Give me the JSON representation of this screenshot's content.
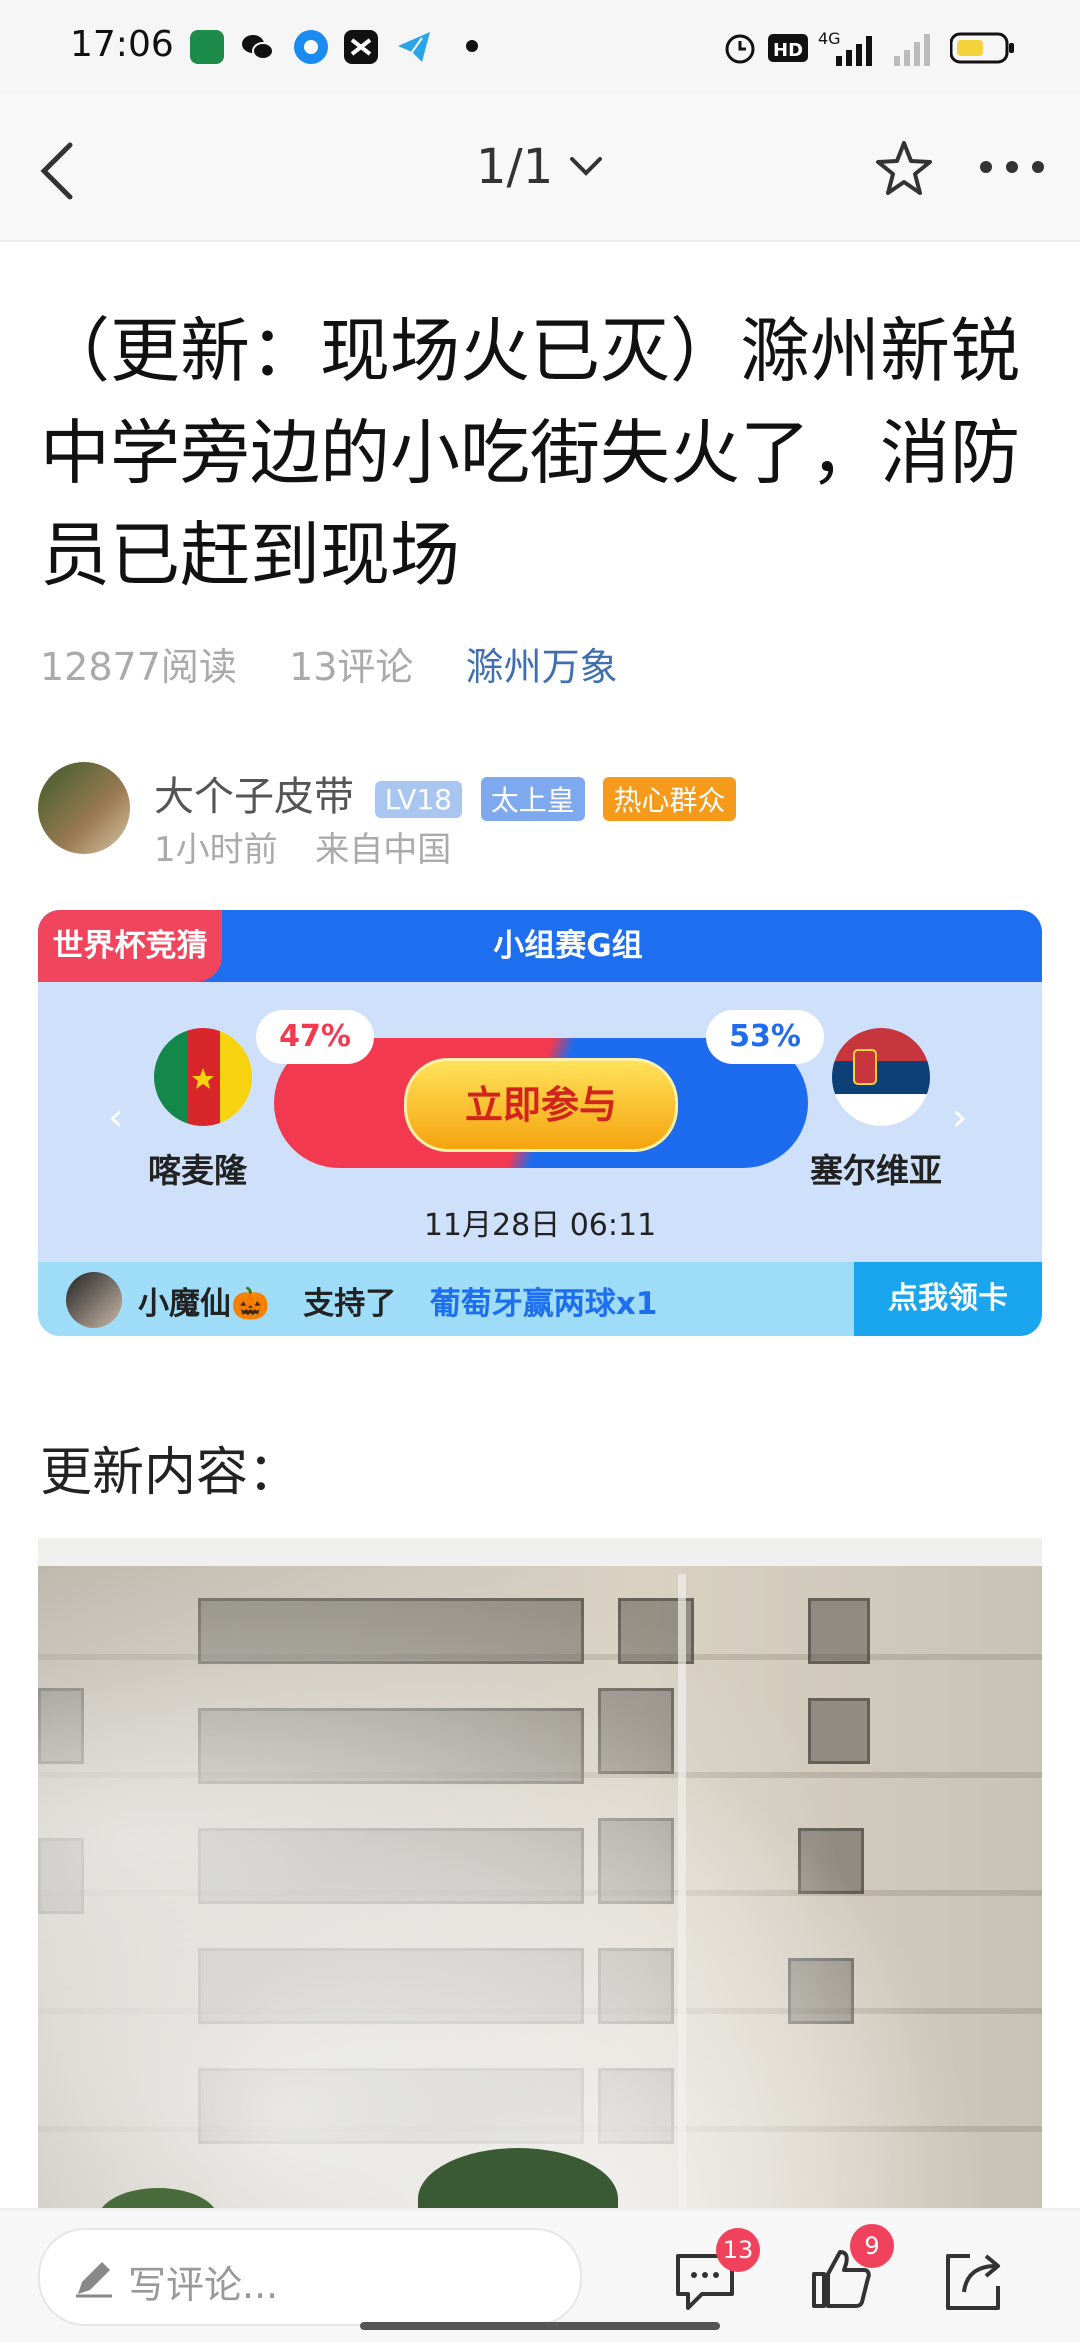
{
  "status_bar": {
    "time": "17:06",
    "icons": [
      "oppo-app-icon",
      "wechat-icon",
      "browser-icon",
      "capcut-icon",
      "telegram-icon",
      "alarm-icon",
      "hd-icon",
      "signal-4g-icon",
      "signal-icon",
      "battery-icon"
    ]
  },
  "nav": {
    "page_indicator": "1/1"
  },
  "article": {
    "title": "（更新：现场火已灭）滁州新锐中学旁边的小吃街失火了，消防员已赶到现场",
    "reads": "12877阅读",
    "comments": "13评论",
    "source": "滁州万象"
  },
  "author": {
    "name": "大个子皮带",
    "level": "LV18",
    "badge1": "太上皇",
    "badge2": "热心群众",
    "time": "1小时前",
    "origin": "来自中国"
  },
  "prediction_card": {
    "tag": "世界杯竞猜",
    "group": "小组赛G组",
    "team_left": "喀麦隆",
    "team_right": "塞尔维亚",
    "pct_left": "47%",
    "pct_right": "53%",
    "join_label": "立即参与",
    "datetime": "11月28日 06:11",
    "supporter_name": "小魔仙🎃",
    "supporter_action": "支持了",
    "supporter_pick": "葡萄牙赢两球x1",
    "claim_label": "点我领卡",
    "colors": {
      "left": "#f3394f",
      "right": "#1d6cf0"
    }
  },
  "content": {
    "update_heading": "更新内容："
  },
  "bottom_bar": {
    "comment_placeholder": "写评论...",
    "comment_count": "13",
    "like_count": "9"
  }
}
